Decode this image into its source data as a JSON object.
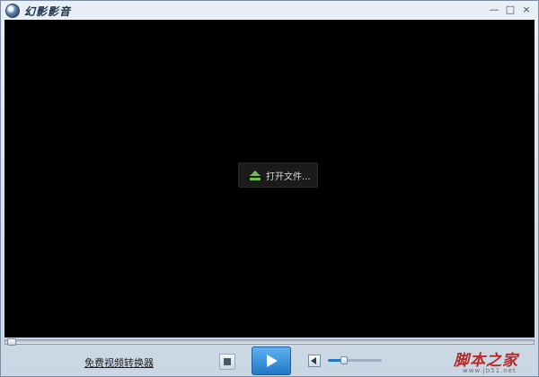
{
  "window": {
    "title": "幻影影音",
    "controls": {
      "minimize": "—",
      "maximize": "□",
      "close": "×"
    }
  },
  "overlay": {
    "open_file_label": "打开文件..."
  },
  "controls_bar": {
    "converter_link": "免费视频转换器",
    "volume_level": 0.3
  },
  "watermark": {
    "logo_text": "脚本之家",
    "url": "www.jb51.net"
  },
  "colors": {
    "accent": "#1f79c8",
    "video_bg": "#000000",
    "eject_green": "#6fbf4a",
    "watermark_red": "#b32b26"
  },
  "icons": [
    "app-logo-icon",
    "eject-icon",
    "stop-icon",
    "play-icon",
    "volume-icon"
  ]
}
